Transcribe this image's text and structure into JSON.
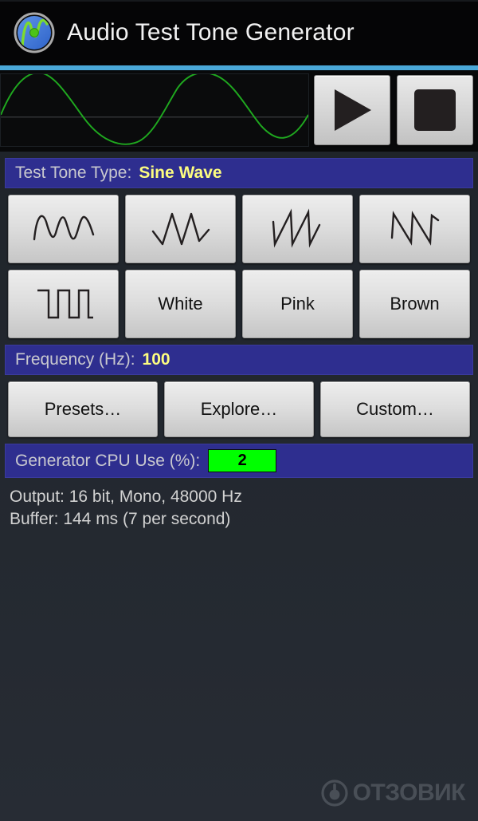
{
  "titlebar": {
    "app_title": "Audio Test Tone Generator",
    "icon_name": "app-logo-sine-wave",
    "accent_color": "#4aa8d8"
  },
  "scope": {
    "name": "waveform-display",
    "wave_color": "#1fa81f",
    "background": "#0a0b0c",
    "cycles": 2,
    "centerline": true
  },
  "transport": {
    "play_label": "Play",
    "stop_label": "Stop"
  },
  "tone_type": {
    "label": "Test Tone Type:",
    "value": "Sine Wave",
    "buttons_row1": [
      {
        "name": "sine",
        "label": ""
      },
      {
        "name": "triangle",
        "label": ""
      },
      {
        "name": "sawtooth-rising",
        "label": ""
      },
      {
        "name": "sawtooth-falling",
        "label": ""
      }
    ],
    "buttons_row2": [
      {
        "name": "square",
        "label": ""
      },
      {
        "name": "white-noise",
        "label": "White"
      },
      {
        "name": "pink-noise",
        "label": "Pink"
      },
      {
        "name": "brown-noise",
        "label": "Brown"
      }
    ]
  },
  "frequency": {
    "label": "Frequency (Hz):",
    "value": "100",
    "buttons": [
      {
        "name": "presets",
        "label": "Presets…"
      },
      {
        "name": "explore",
        "label": "Explore…"
      },
      {
        "name": "custom",
        "label": "Custom…"
      }
    ]
  },
  "cpu": {
    "label": "Generator CPU Use (%):",
    "value": "2",
    "badge_color": "#00ff00"
  },
  "status": {
    "output_line": "Output: 16 bit, Mono, 48000 Hz",
    "buffer_line": "Buffer: 144 ms (7 per second)"
  },
  "watermark": {
    "text": "ОТЗОВИК"
  },
  "colors": {
    "bar_blue": "#2e2e8f",
    "value_yellow": "#fdfd80",
    "label_grey": "#c9c9cf",
    "page_bg": "#22272e"
  }
}
